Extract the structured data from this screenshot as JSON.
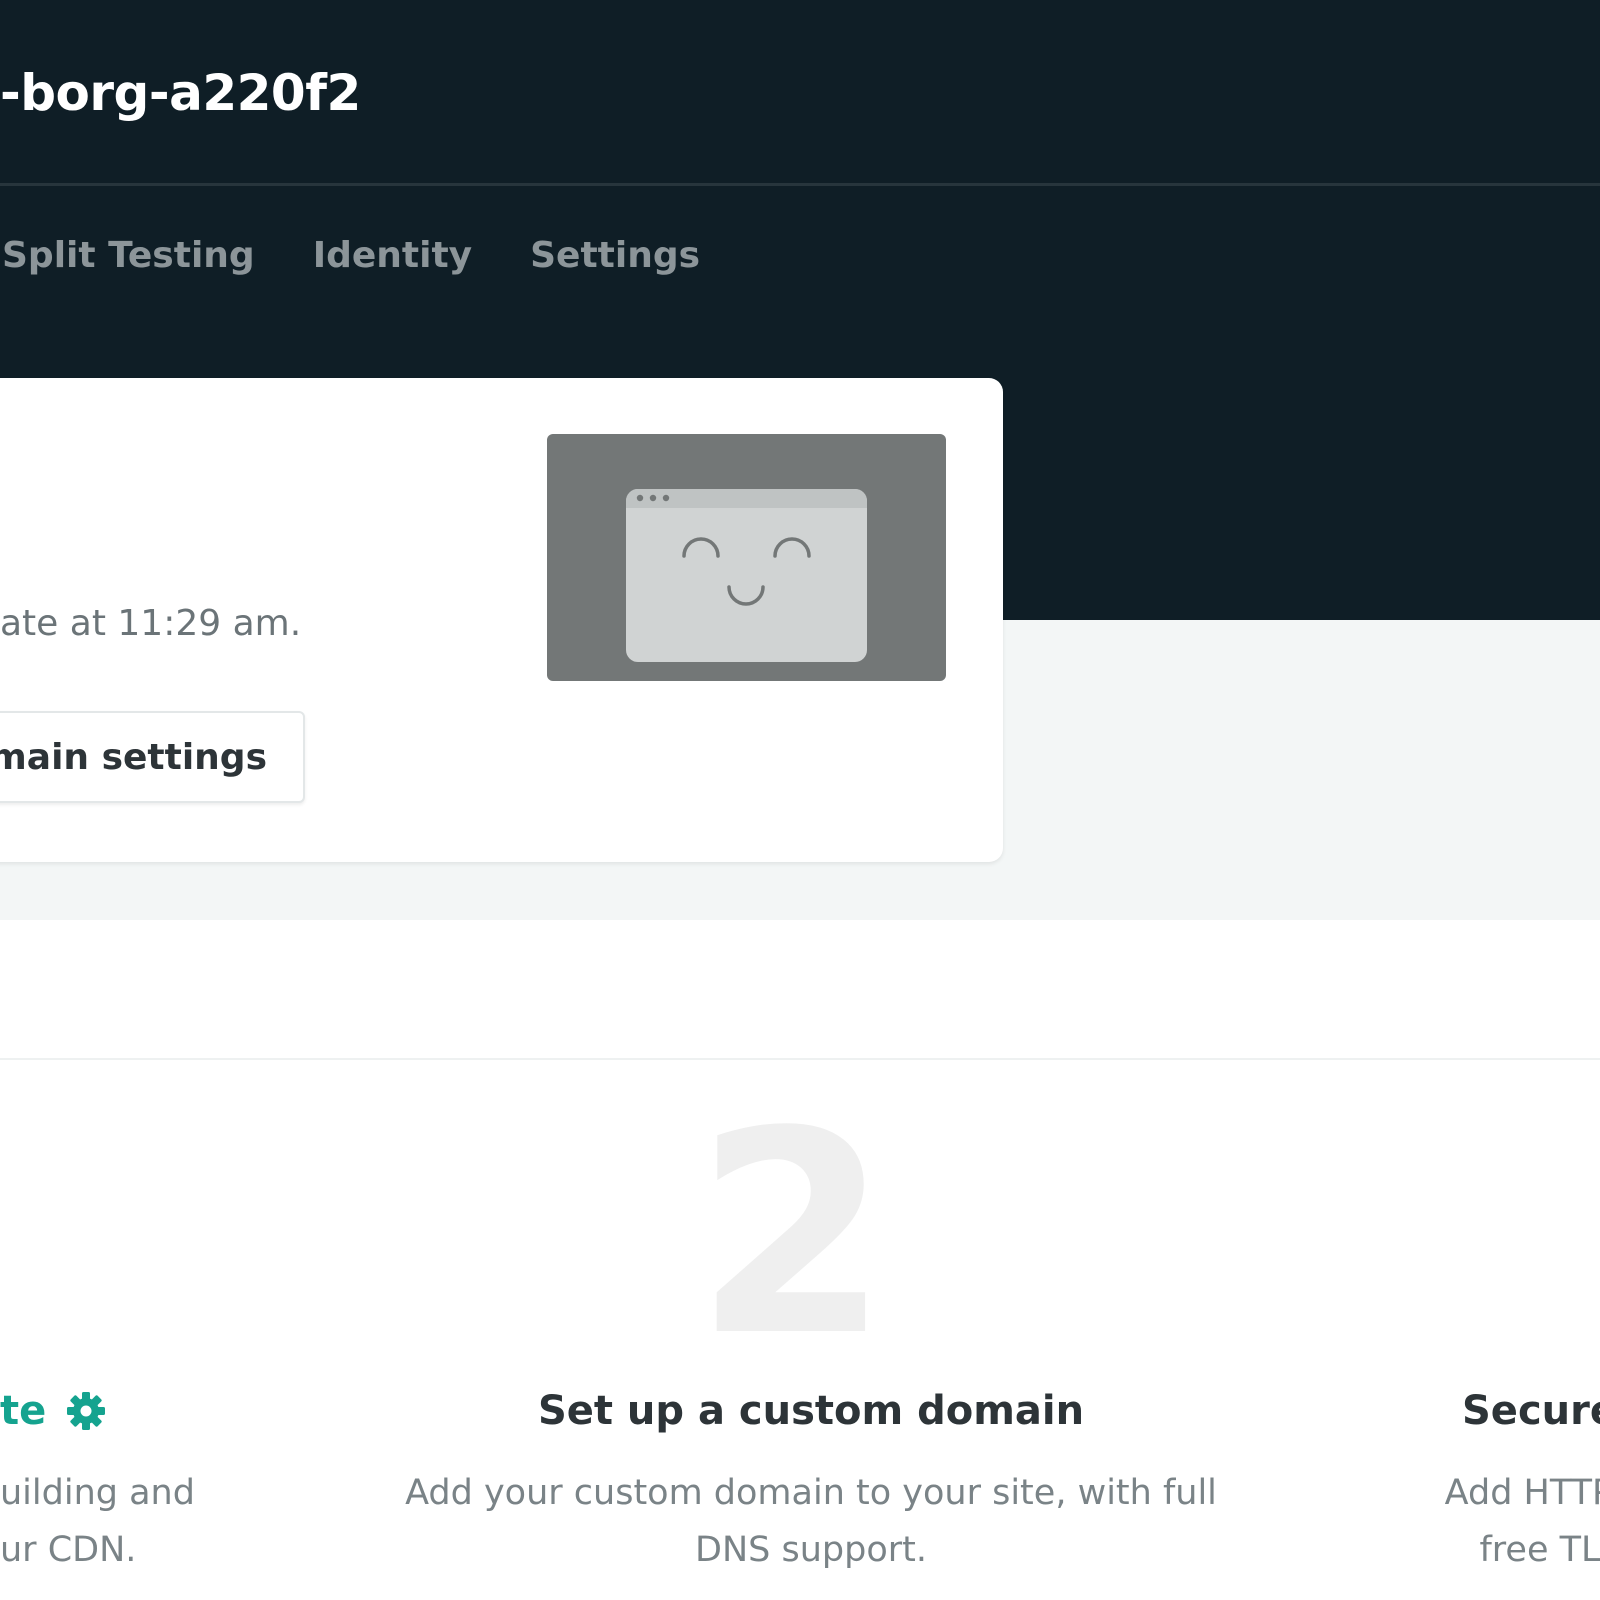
{
  "header": {
    "site_title": "-borg-a220f2",
    "tabs": [
      {
        "label": "Split Testing"
      },
      {
        "label": "Identity"
      },
      {
        "label": "Settings"
      }
    ]
  },
  "card": {
    "deploy_text": "ate at 11:29 am.",
    "domain_button_label": "omain settings",
    "preview_icon": "happy-browser-window-icon"
  },
  "steps": {
    "step1": {
      "title": "te",
      "icon": "gear-icon",
      "description": "uilding and\nur CDN."
    },
    "step2": {
      "number": "2",
      "title": "Set up a custom domain",
      "description": "Add your custom domain to your site, with full DNS support."
    },
    "step3": {
      "title": "Secure",
      "description": "Add HTTPS\nfree TL"
    }
  },
  "colors": {
    "header_bg": "#0f1e26",
    "accent": "#15a38f",
    "band_bg": "#f3f6f6"
  }
}
